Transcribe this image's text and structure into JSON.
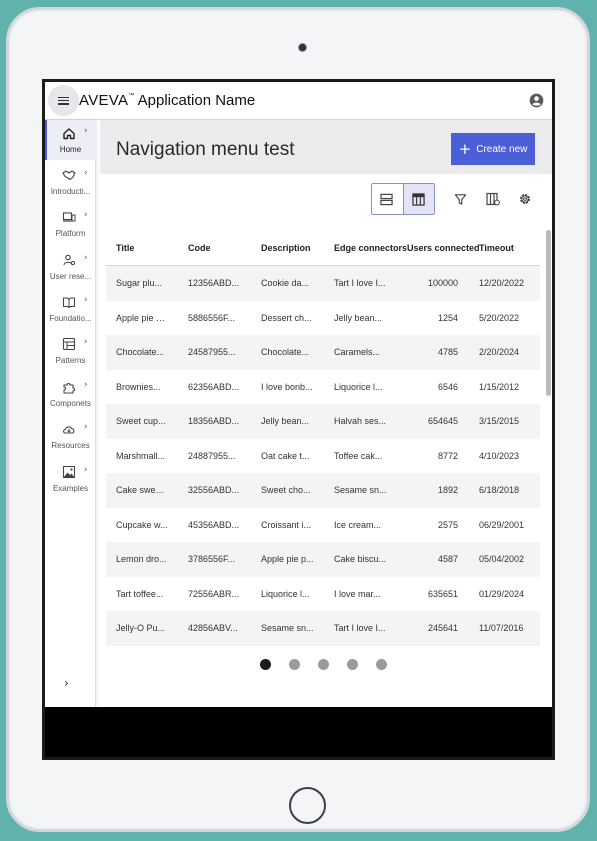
{
  "app": {
    "brand": "AVEVA",
    "trademark": "™",
    "name": "Application Name"
  },
  "sidebar": {
    "items": [
      {
        "label": "Home",
        "icon": "home-icon",
        "active": true
      },
      {
        "label": "Introducti...",
        "icon": "handshake-icon",
        "active": false
      },
      {
        "label": "Platform",
        "icon": "devices-icon",
        "active": false
      },
      {
        "label": "User rese...",
        "icon": "user-research-icon",
        "active": false
      },
      {
        "label": "Foundatio...",
        "icon": "book-icon",
        "active": false
      },
      {
        "label": "Patterns",
        "icon": "patterns-icon",
        "active": false
      },
      {
        "label": "Componets",
        "icon": "puzzle-icon",
        "active": false
      },
      {
        "label": "Resources",
        "icon": "cloud-download-icon",
        "active": false
      },
      {
        "label": "Examples",
        "icon": "image-icon",
        "active": false
      }
    ],
    "chevron": "›",
    "expand_chevron": "›"
  },
  "page": {
    "title": "Navigation menu test",
    "create_button": "Create new",
    "create_plus": "+"
  },
  "table": {
    "columns": [
      "Title",
      "Code",
      "Description",
      "Edge connectors",
      "Users connected",
      "Timeout"
    ],
    "rows": [
      [
        "Sugar plu...",
        "12356ABD...",
        "Cookie da...",
        "Tart I love I...",
        "100000",
        "12/20/2022"
      ],
      [
        "Apple pie p...",
        "5886556F...",
        "Dessert ch...",
        "Jelly bean...",
        "1254",
        "5/20/2022"
      ],
      [
        "Chocolate...",
        "24587955...",
        "Chocolate...",
        "Caramels...",
        "4785",
        "2/20/2024"
      ],
      [
        "Brownies...",
        "62356ABD...",
        "I love bonb...",
        "Liquorice l...",
        "6546",
        "1/15/2012"
      ],
      [
        "Sweet cup...",
        "18356ABD...",
        "Jelly bean...",
        "Halvah ses...",
        "654645",
        "3/15/2015"
      ],
      [
        "Marshmall...",
        "24887955...",
        "Oat cake t...",
        "Toffee cak...",
        "8772",
        "4/10/2023"
      ],
      [
        "Cake swee...",
        "32556ABD...",
        "Sweet cho...",
        "Sesame sn...",
        "1892",
        "6/18/2018"
      ],
      [
        "Cupcake w...",
        "45356ABD...",
        "Croissant i...",
        "Ice cream...",
        "2575",
        "06/29/2001"
      ],
      [
        "Lemon dro...",
        "3786556F...",
        "Apple pie p...",
        "Cake biscu...",
        "4587",
        "05/04/2002"
      ],
      [
        "Tart toffee...",
        "72556ABR...",
        "Liquorice l...",
        "I love mar...",
        "635651",
        "01/29/2024"
      ],
      [
        "Jelly-O Pu...",
        "42856ABV...",
        "Sesame sn...",
        "Tart I love I...",
        "245641",
        "11/07/2016"
      ]
    ]
  },
  "pagination": {
    "pages": 5,
    "current": 1
  },
  "colors": {
    "accent": "#4b5fd6",
    "background": "#5fb3ac"
  }
}
